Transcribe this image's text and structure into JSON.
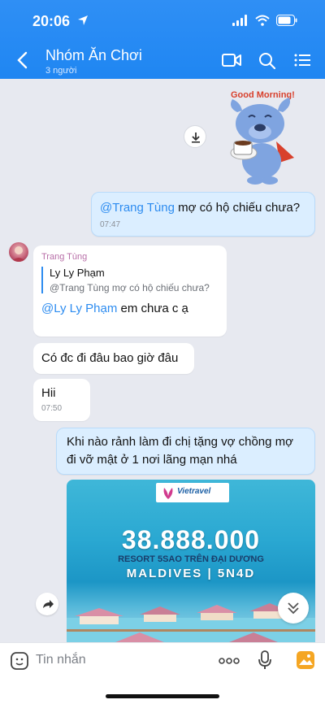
{
  "status_bar": {
    "time": "20:06"
  },
  "header": {
    "title": "Nhóm Ăn Chơi",
    "subtitle": "3 người"
  },
  "sticker": {
    "label": "Good Morning!"
  },
  "messages": {
    "m1": {
      "mention": "@Trang Tùng",
      "text": " mợ có hộ chiếu chưa?",
      "time": "07:47"
    },
    "m2": {
      "sender": "Trang Tùng",
      "quote_author": "Ly Ly Phạm",
      "quote_text": "@Trang Tùng mợ có hộ chiếu chưa?",
      "mention": "@Ly Ly Phạm",
      "text": " em chưa c ạ"
    },
    "m3": {
      "text": "Có đc đi đâu bao giờ đâu"
    },
    "m4": {
      "text": "Hii",
      "time": "07:50"
    },
    "m5": {
      "line1": "Khi nào rảnh làm đi chị tặng vợ chồng mợ",
      "line2": "đi vỡ mật ở 1 nơi lãng mạn nhá"
    }
  },
  "promo_image": {
    "logo": "Vietravel",
    "price": "38.888.000",
    "resort": "RESORT 5SAO TRÊN ĐẠI DƯƠNG",
    "place": "MALDIVES | 5N4D"
  },
  "input": {
    "placeholder": "Tin nhắn"
  },
  "colors": {
    "accent": "#1f86f2",
    "outgoing_bubble": "#dbeeff",
    "mention": "#2d8cf0",
    "sender_name": "#b86fa8"
  }
}
